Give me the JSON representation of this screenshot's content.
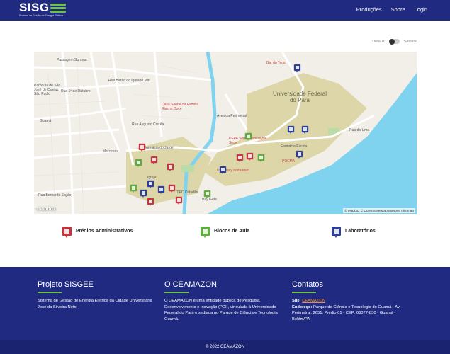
{
  "header": {
    "logo_text": "SISG",
    "logo_subtitle": "Sistema de Gestão de Energia Elétrica",
    "nav": [
      "Produções",
      "Sobre",
      "Login"
    ]
  },
  "map_toggle": {
    "left_label": "Default",
    "right_label": "Satélite"
  },
  "map": {
    "labels": {
      "street1": "Passagem Suruma",
      "street2": "Rua Barão do Igarapé Miri",
      "street3": "Rua 1º de Outubro",
      "street4": "Rua Augusto Corrêa",
      "street5": "Avenida Perimetral",
      "street6": "Rua Bernardo Sayão",
      "street7": "Rua do Uma",
      "place1": "Universidade Federal do Pará",
      "place2": "Casa Saúde da Família Riacho Doce",
      "place3": "Farmácia do Jarde",
      "place4": "UFPA Setor Profissional Sede",
      "place5": "Farmácia Escola",
      "place6": "University restaurant",
      "place7": "Bar do Tecu",
      "place8": "ITEC Cidadão",
      "place9": "Bay Gate",
      "place10": "Mercearia",
      "place11": "Paróquia de São José de Queluz São Paulo",
      "place12": "POEMA",
      "place13": "Igreja",
      "place14": "Guamá",
      "mapbox_logo": "mapbox",
      "attribution": "© Mapbox © OpenStreetMap Improve this map"
    }
  },
  "legend": {
    "admin": "Prédios Administrativos",
    "aula": "Blocos de Aula",
    "lab": "Laboratórios"
  },
  "footer": {
    "col1": {
      "title": "Projeto SISGEE",
      "text": "Sistema de Gestão de Energia Elétrica da Cidade Universitária José da Silveira Neto."
    },
    "col2": {
      "title": "O CEAMAZON",
      "text": "O CEAMAZON é uma entidade pública de Pesquisa, Desenvolvimento e Inovação (PDI), vinculada à Universidade Federal do Pará e sediada no Parque de Ciência e Tecnologia Guamá."
    },
    "col3": {
      "title": "Contatos",
      "site_label": "Site:",
      "site_value": "CEAMAZON",
      "address_label": "Endereço:",
      "address_value": "Parque de Ciência e Tecnologia do Guamá - Av. Perimetral, 2651, Prédio 01 - CEP: 66077-830 - Guamá - Belém/PA"
    },
    "copyright": "© 2022 CEAMAZON"
  },
  "colors": {
    "navy": "#1f2a80",
    "green": "#6cc24a",
    "admin": "#c8333c",
    "aula": "#5db13a",
    "lab": "#2c3f9e",
    "orange": "#f28c28"
  }
}
